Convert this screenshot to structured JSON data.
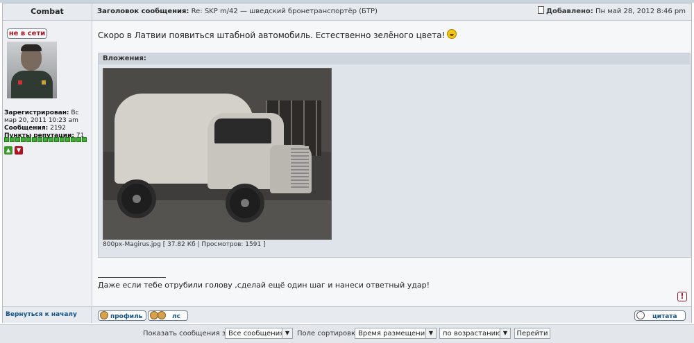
{
  "header": {
    "author_col": "Combat",
    "subject_label": "Заголовок сообщения:",
    "subject": "Re: SKP m/42 — шведский бронетранспортёр (БТР)",
    "posted_label": "Добавлено:",
    "posted": "Пн май 28, 2012 8:46 pm"
  },
  "author": {
    "status": "не в сети",
    "registered_label": "Зарегистрирован:",
    "registered": "Вс мар 20, 2011 10:23 am",
    "posts_label": "Сообщения:",
    "posts": "2192",
    "rep_label": "Пункты репутации:",
    "rep": "71",
    "rep_fill": 1.0
  },
  "post": {
    "text": "Скоро в Латвии появиться штабной автомобиль. Естественно зелёного цвета!",
    "smiley": "grin-smiley-icon",
    "attachments_label": "Вложения:",
    "file_info": "800px-Magirus.jpg [ 37.82 Кб | Просмотров: 1591 ]",
    "signature": "Даже если тебе отрубили голову ,сделай ещё один шаг и нанеси ответный удар!",
    "report_glyph": "!"
  },
  "footer": {
    "back_to_top": "Вернуться к началу",
    "profile_btn": "профиль",
    "pm_btn": "лс",
    "quote_btn": "цитата"
  },
  "sortbar": {
    "show_label": "Показать сообщения за:",
    "show_value": "Все сообщения",
    "sort_label": "Поле сортировки",
    "sort_value": "Время размещения",
    "order_value": "по возрастанию",
    "go_label": "Перейти"
  },
  "colors": {
    "link": "#105289",
    "offline": "#b01020",
    "rep": "#3fae33"
  }
}
